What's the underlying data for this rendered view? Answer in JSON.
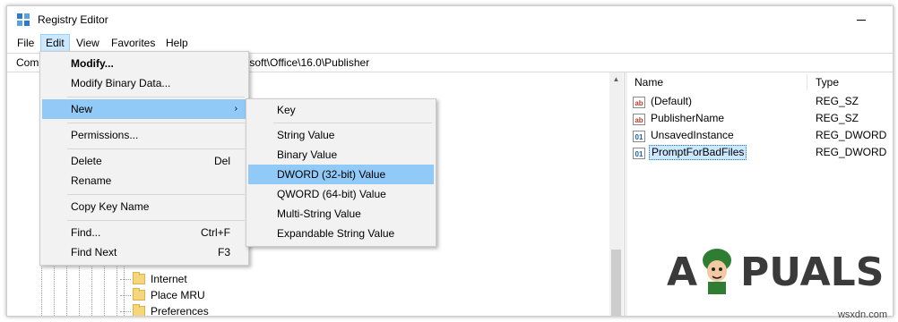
{
  "window": {
    "title": "Registry Editor"
  },
  "menubar": [
    "File",
    "Edit",
    "View",
    "Favorites",
    "Help"
  ],
  "address": {
    "prefix": "Com",
    "suffix": "soft\\Office\\16.0\\Publisher"
  },
  "tree": {
    "items": [
      "Internet",
      "Place MRU",
      "Preferences"
    ]
  },
  "list": {
    "headers": {
      "name": "Name",
      "type": "Type"
    },
    "rows": [
      {
        "icon": "string-value-icon",
        "name": "(Default)",
        "type": "REG_SZ"
      },
      {
        "icon": "string-value-icon",
        "name": "PublisherName",
        "type": "REG_SZ"
      },
      {
        "icon": "binary-value-icon",
        "name": "UnsavedInstance",
        "type": "REG_DWORD"
      },
      {
        "icon": "binary-value-icon",
        "name": "PromptForBadFiles",
        "type": "REG_DWORD",
        "selected": true
      }
    ]
  },
  "edit_menu": {
    "items": [
      {
        "label": "Modify...",
        "bold": true
      },
      {
        "label": "Modify Binary Data..."
      },
      {
        "label": "New",
        "submenu": true,
        "highlighted": true
      },
      {
        "label": "Permissions..."
      },
      {
        "label": "Delete",
        "shortcut": "Del"
      },
      {
        "label": "Rename"
      },
      {
        "label": "Copy Key Name"
      },
      {
        "label": "Find...",
        "shortcut": "Ctrl+F"
      },
      {
        "label": "Find Next",
        "shortcut": "F3"
      }
    ]
  },
  "new_submenu": {
    "items": [
      {
        "label": "Key"
      },
      {
        "label": "String Value"
      },
      {
        "label": "Binary Value"
      },
      {
        "label": "DWORD (32-bit) Value",
        "highlighted": true
      },
      {
        "label": "QWORD (64-bit) Value"
      },
      {
        "label": "Multi-String Value"
      },
      {
        "label": "Expandable String Value"
      }
    ]
  },
  "watermark": {
    "text_before": "A",
    "text_after": "PUALS"
  },
  "credit": "wsxdn.com",
  "colors": {
    "highlight": "#91c9f7",
    "selection": "#cce8ff",
    "folder": "#f6d67c",
    "accent": "#1e6fcf"
  }
}
